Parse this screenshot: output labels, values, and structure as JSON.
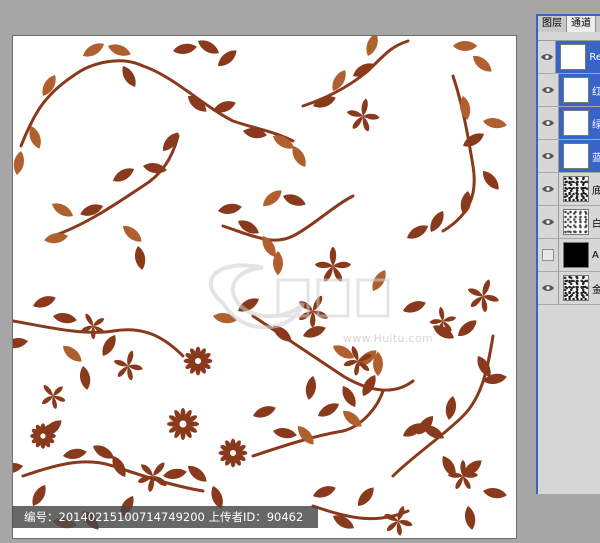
{
  "caption": "编号：20140215100714749200 上传者ID：90462",
  "watermark": {
    "site_text": "www.Huitu.com"
  },
  "panel": {
    "tabs": [
      "图层",
      "通道"
    ],
    "layers": [
      {
        "name": "Re",
        "thumb": "white",
        "selected": true,
        "visible": true
      },
      {
        "name": "红",
        "thumb": "white",
        "selected": true,
        "visible": true
      },
      {
        "name": "绿",
        "thumb": "white",
        "selected": true,
        "visible": true
      },
      {
        "name": "蓝",
        "thumb": "white",
        "selected": true,
        "visible": true
      },
      {
        "name": "底",
        "thumb": "noise",
        "selected": false,
        "visible": true
      },
      {
        "name": "白",
        "thumb": "noise2",
        "selected": false,
        "visible": true
      },
      {
        "name": "A",
        "thumb": "black",
        "selected": false,
        "visible": false
      },
      {
        "name": "金",
        "thumb": "noise",
        "selected": false,
        "visible": true
      }
    ]
  },
  "colors": {
    "motif": "#8a3a1c",
    "motif_light": "#b0602f",
    "selection": "#3864c8"
  },
  "icons": {
    "eye": "eye-icon"
  }
}
